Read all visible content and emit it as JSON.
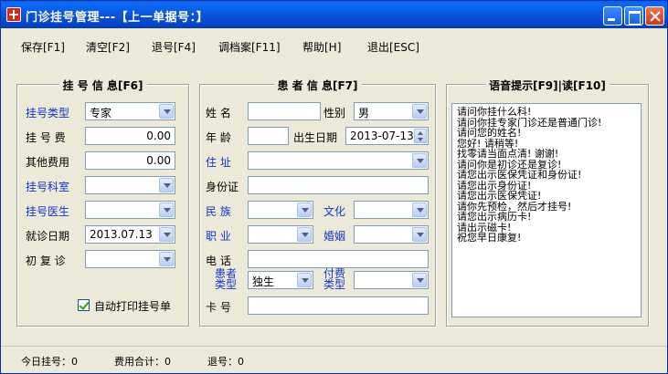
{
  "window": {
    "title": "门诊挂号管理---【上一单据号：】"
  },
  "menu": {
    "items": [
      "保存[F1]",
      "清空[F2]",
      "退号[F4]",
      "调档案[F11]",
      "帮助[H]",
      "退出[ESC]"
    ]
  },
  "registration": {
    "title": "挂 号 信 息[F6]",
    "type_label": "挂号类型",
    "type_value": "专家",
    "fee_label": "挂 号 费",
    "fee_value": "0.00",
    "other_label": "其他费用",
    "other_value": "0.00",
    "dept_label": "挂号科室",
    "dept_value": "",
    "doctor_label": "挂号医生",
    "doctor_value": "",
    "date_label": "就诊日期",
    "date_value": "2013.07.13",
    "visit_label": "初 复 诊",
    "visit_value": "",
    "autoprint_label": "自动打印挂号单",
    "autoprint_checked": true
  },
  "patient": {
    "title": "患 者 信 息[F7]",
    "name_label": "姓  名",
    "name_value": "",
    "gender_label": "性别",
    "gender_value": "男",
    "age_label": "年  龄",
    "age_value": "",
    "birth_label": "出生日期",
    "birth_value": "2013-07-13",
    "address_label": "住  址",
    "address_value": "",
    "idcard_label": "身份证",
    "idcard_value": "",
    "nation_label": "民  族",
    "nation_value": "",
    "education_label": "文化",
    "education_value": "",
    "job_label": "职  业",
    "job_value": "",
    "marriage_label": "婚姻",
    "marriage_value": "",
    "phone_label": "电  话",
    "phone_value": "",
    "ptype_label_1": "患者",
    "ptype_label_2": "类型",
    "ptype_value": "独生",
    "paytype_label_1": "付费",
    "paytype_label_2": "类型",
    "paytype_value": "",
    "card_label": "卡  号",
    "card_value": ""
  },
  "voice": {
    "title": "语音提示[F9]|读[F10]",
    "lines": [
      "请问你挂什么科!",
      "请问你挂专家门诊还是普通门诊!",
      "请问您的姓名!",
      "您好! 请稍等!",
      "找零请当面点清! 谢谢!",
      "请问你是初诊还是复诊!",
      "请您出示医保凭证和身份证!",
      "请您出示身份证!",
      "请您出示医保凭证!",
      "请你先预检，然后才挂号!",
      "请您出示病历卡!",
      "请出示磁卡!",
      "祝您早日康复!"
    ]
  },
  "status": {
    "today_label": "今日挂号：",
    "today_value": "0",
    "fee_label": "费用合计：",
    "fee_value": "0",
    "refund_label": "退号：",
    "refund_value": "0"
  },
  "colors": {
    "accent_label": "#1136c8",
    "titlebar": "#0a55dc",
    "background": "#ece9d8"
  }
}
